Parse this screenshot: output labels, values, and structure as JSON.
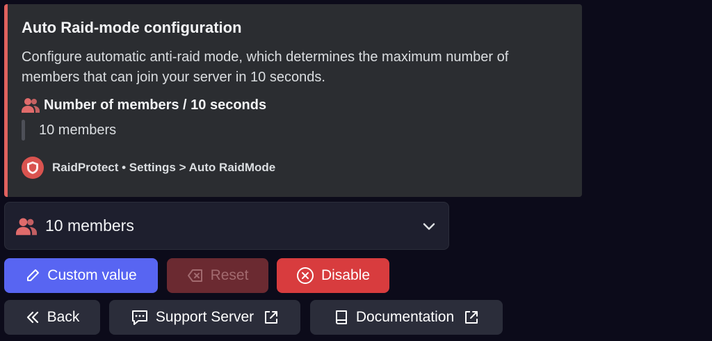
{
  "embed": {
    "title": "Auto Raid-mode configuration",
    "description": "Configure automatic anti-raid mode, which determines the maximum number of members that can join your server in 10 seconds.",
    "field_name": "Number of members / 10 seconds",
    "field_value": "10 members",
    "footer_text": "RaidProtect • Settings > Auto RaidMode",
    "accent_color": "#e0615f"
  },
  "select": {
    "selected_value": "10 members",
    "icon": "members-icon"
  },
  "buttons": {
    "custom_value": "Custom value",
    "reset": "Reset",
    "disable": "Disable",
    "back": "Back",
    "support_server": "Support Server",
    "documentation": "Documentation"
  },
  "colors": {
    "primary": "#5865f2",
    "danger": "#d83c3e",
    "secondary": "#2b2d3a"
  }
}
